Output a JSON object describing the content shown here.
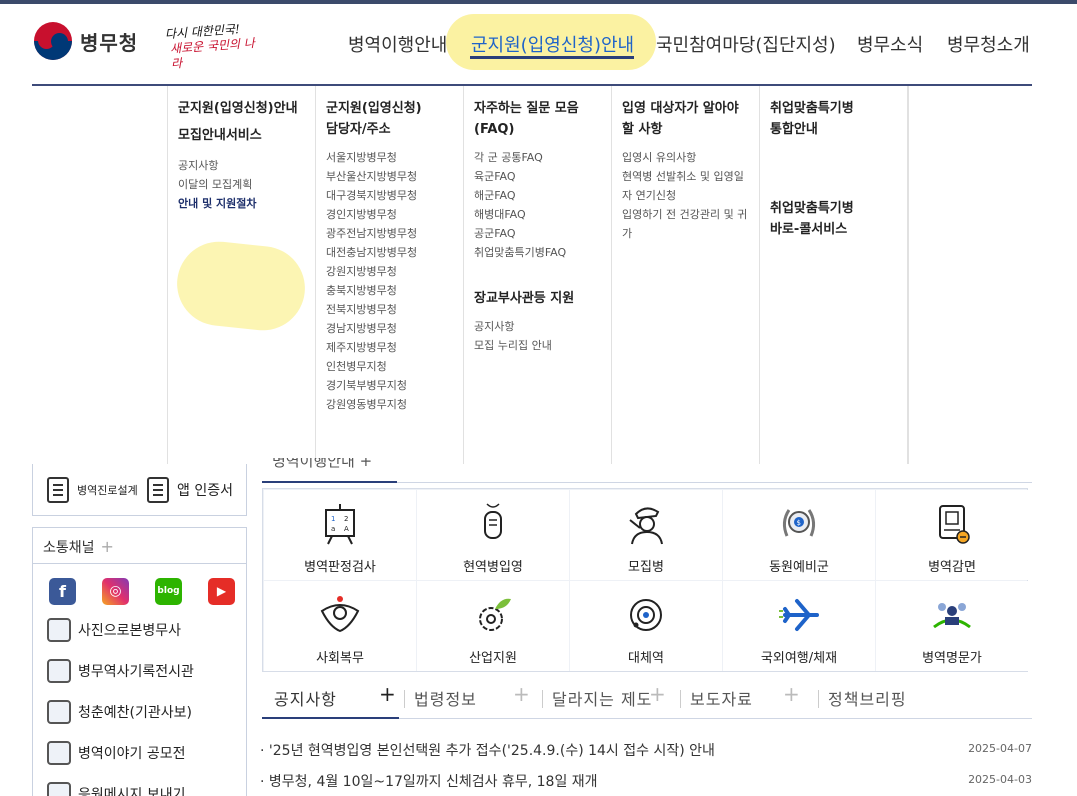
{
  "header": {
    "logo_text": "병무청",
    "slogan_line1": "다시 대한민국!",
    "slogan_line2": "새로운 국민의 나라",
    "gnb": [
      {
        "label": "병역이행안내"
      },
      {
        "label": "군지원(입영신청)안내"
      },
      {
        "label": "국민참여마당(집단지성)"
      },
      {
        "label": "병무소식"
      },
      {
        "label": "병무청소개"
      }
    ],
    "active_color": "#1e63c9",
    "brand_color": "#2a3f7a"
  },
  "mega": {
    "col1": {
      "title_a": "군지원(입영신청)안내",
      "title_b": "모집안내서비스",
      "links": [
        "공지사항",
        "이달의 모집계획",
        "안내 및 지원절차"
      ]
    },
    "col2": {
      "title_a": "군지원(입영신청)",
      "title_b": "담당자/주소",
      "links": [
        "서울지방병무청",
        "부산울산지방병무청",
        "대구경북지방병무청",
        "경인지방병무청",
        "광주전남지방병무청",
        "대전충남지방병무청",
        "강원지방병무청",
        "충북지방병무청",
        "전북지방병무청",
        "경남지방병무청",
        "제주지방병무청",
        "인천병무지청",
        "경기북부병무지청",
        "강원영동병무지청"
      ]
    },
    "col3": {
      "title_a": "자주하는 질문 모음",
      "title_b": "(FAQ)",
      "links": [
        "각 군 공통FAQ",
        "육군FAQ",
        "해군FAQ",
        "해병대FAQ",
        "공군FAQ",
        "취업맞춤특기병FAQ"
      ],
      "sub_title": "장교부사관등 지원",
      "sub_links": [
        "공지사항",
        "모집 누리집 안내"
      ]
    },
    "col4": {
      "title_a": "입영 대상자가 알아야",
      "title_b": "할 사항",
      "links": [
        "입영시 유의사항",
        "현역병 선발취소 및 입영일",
        "자 연기신청",
        "입영하기 전 건강관리 및 귀",
        "가"
      ]
    },
    "col5": {
      "title_a": "취업맞춤특기병",
      "title_b": "통합안내",
      "title_c": "취업맞춤특기병",
      "title_d": "바로-콜서비스"
    }
  },
  "sidebar": {
    "quick": [
      {
        "label": "병역진로설계",
        "icon": "career-icon"
      },
      {
        "label": "앱 인증서",
        "icon": "certificate-icon"
      }
    ],
    "channels_title": "소통채널",
    "plus": "+",
    "sns": [
      {
        "name": "facebook",
        "glyph": "f"
      },
      {
        "name": "instagram",
        "glyph": "◎"
      },
      {
        "name": "blog",
        "glyph": "blog"
      },
      {
        "name": "youtube",
        "glyph": "▶"
      }
    ],
    "links": [
      {
        "label": "사진으로본병무사",
        "icon": "photo-icon"
      },
      {
        "label": "병무역사기록전시관",
        "icon": "book-icon"
      },
      {
        "label": "청춘예찬(기관사보)",
        "icon": "magazine-icon"
      },
      {
        "label": "병역이야기 공모전",
        "icon": "clapper-icon"
      },
      {
        "label": "응원메시지 보내기",
        "icon": "mail-icon"
      }
    ]
  },
  "main": {
    "partial_tab": "병역이행안내 +",
    "services": [
      {
        "label": "병역판정검사",
        "icon": "exam-board-icon"
      },
      {
        "label": "현역병입영",
        "icon": "dog-tag-icon"
      },
      {
        "label": "모집병",
        "icon": "soldier-salute-icon"
      },
      {
        "label": "동원예비군",
        "icon": "reserve-emblem-icon"
      },
      {
        "label": "병역감면",
        "icon": "document-badge-icon"
      },
      {
        "label": "사회복무",
        "icon": "social-service-emblem-icon"
      },
      {
        "label": "산업지원",
        "icon": "gear-leaf-icon"
      },
      {
        "label": "대체역",
        "icon": "orbit-icon"
      },
      {
        "label": "국외여행/체재",
        "icon": "airplane-icon"
      },
      {
        "label": "병역명문가",
        "icon": "family-icon"
      }
    ],
    "notice_tabs": [
      {
        "label": "공지사항",
        "plus": "+"
      },
      {
        "label": "법령정보",
        "plus": "+"
      },
      {
        "label": "달라지는 제도",
        "plus": "+"
      },
      {
        "label": "보도자료",
        "plus": "+"
      },
      {
        "label": "정책브리핑"
      }
    ],
    "notices": [
      {
        "title": "· '25년 현역병입영 본인선택원 추가 접수('25.4.9.(수) 14시 접수 시작) 안내",
        "date": "2025-04-07"
      },
      {
        "title": "· 병무청, 4월 10일~17일까지 신체검사 휴무, 18일 재개",
        "date": "2025-04-03"
      }
    ]
  }
}
